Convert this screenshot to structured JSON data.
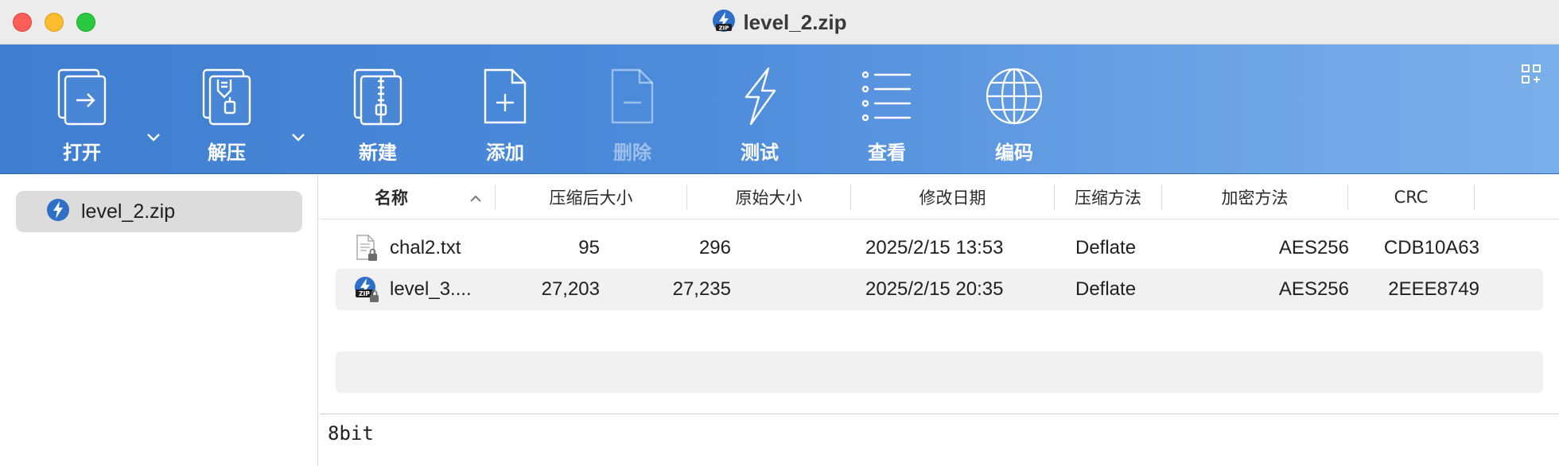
{
  "window": {
    "title": "level_2.zip",
    "title_icon": "zip-archive-icon",
    "traffic_lights": {
      "close": "#ff5f57",
      "minimize": "#febc2e",
      "maximize": "#28c840"
    }
  },
  "toolbar": {
    "accent": "#3f7ed0",
    "items": [
      {
        "label": "打开",
        "icon": "open-icon",
        "enabled": true
      },
      {
        "label": "解压",
        "icon": "extract-icon",
        "enabled": true
      },
      {
        "label": "新建",
        "icon": "new-archive-icon",
        "enabled": true
      },
      {
        "label": "添加",
        "icon": "add-file-icon",
        "enabled": true
      },
      {
        "label": "删除",
        "icon": "delete-file-icon",
        "enabled": false
      },
      {
        "label": "测试",
        "icon": "lightning-icon",
        "enabled": true
      },
      {
        "label": "查看",
        "icon": "list-view-icon",
        "enabled": true
      },
      {
        "label": "编码",
        "icon": "globe-icon",
        "enabled": true
      }
    ],
    "right_icon": "grid-layout-icon"
  },
  "sidebar": {
    "items": [
      {
        "label": "level_2.zip",
        "icon": "zip-archive-icon",
        "selected": true
      }
    ]
  },
  "table": {
    "columns": [
      "名称",
      "压缩后大小",
      "原始大小",
      "修改日期",
      "压缩方法",
      "加密方法",
      "CRC"
    ],
    "sort": {
      "column": "名称",
      "direction": "ascending"
    },
    "rows": [
      {
        "name": "chal2.txt",
        "icon": "locked-text-file-icon",
        "compressed": "95",
        "original": "296",
        "modified": "2025/2/15 13:53",
        "method": "Deflate",
        "encryption": "AES256",
        "crc": "CDB10A63"
      },
      {
        "name": "level_3....",
        "icon": "locked-zip-file-icon",
        "compressed": "27,203",
        "original": "27,235",
        "modified": "2025/2/15 20:35",
        "method": "Deflate",
        "encryption": "AES256",
        "crc": "2EEE8749"
      }
    ]
  },
  "comment": {
    "text": "8bit"
  }
}
